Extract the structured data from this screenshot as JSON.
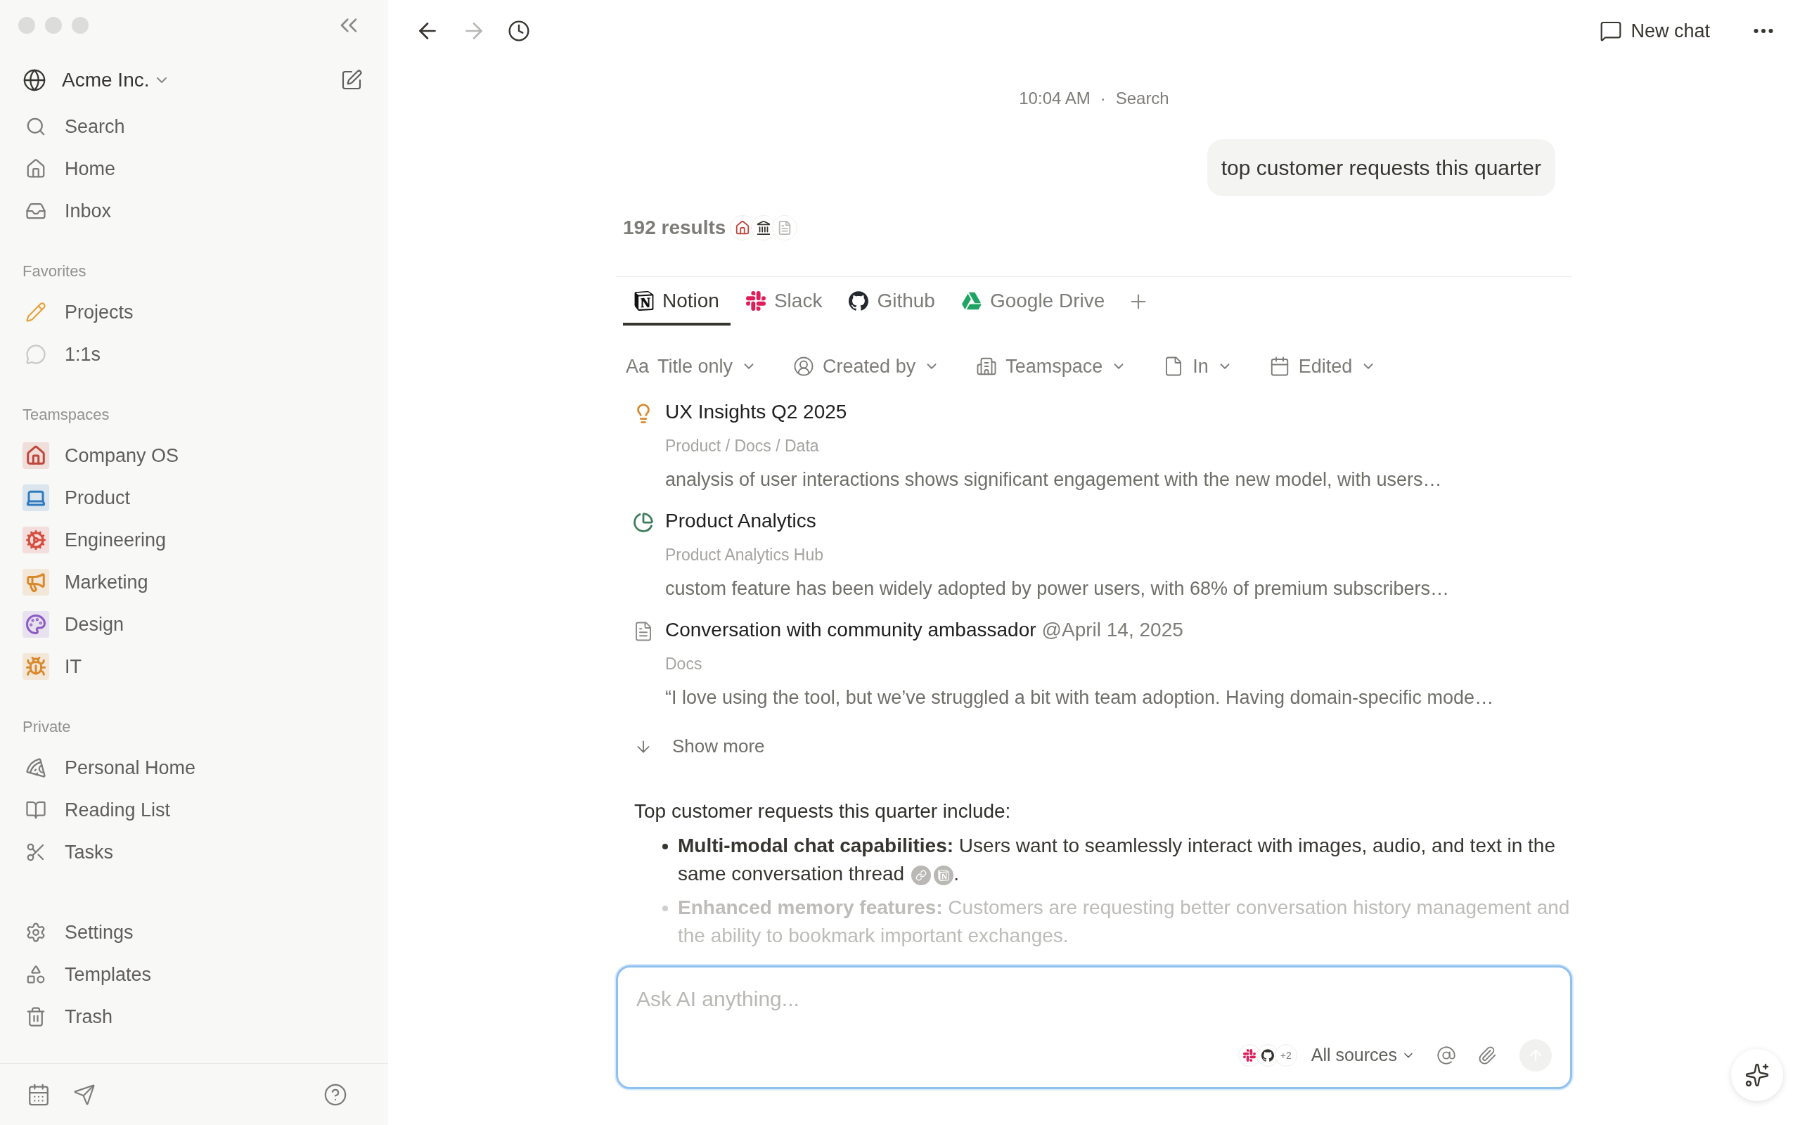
{
  "sidebar": {
    "workspace": {
      "name": "Acme Inc."
    },
    "nav": [
      {
        "label": "Search"
      },
      {
        "label": "Home"
      },
      {
        "label": "Inbox"
      }
    ],
    "sections": [
      {
        "title": "Favorites",
        "items": [
          {
            "label": "Projects",
            "color": "#e6a23c"
          },
          {
            "label": "1:1s",
            "color": "#c9c9c9"
          }
        ]
      },
      {
        "title": "Teamspaces",
        "items": [
          {
            "label": "Company OS",
            "color": "#c0473c"
          },
          {
            "label": "Product",
            "color": "#2f7bbf"
          },
          {
            "label": "Engineering",
            "color": "#d44c3f"
          },
          {
            "label": "Marketing",
            "color": "#d9892b"
          },
          {
            "label": "Design",
            "color": "#8a5bc4"
          },
          {
            "label": "IT",
            "color": "#d9892b"
          }
        ]
      },
      {
        "title": "Private",
        "items": [
          {
            "label": "Personal Home",
            "color": "#7d7c78"
          },
          {
            "label": "Reading List",
            "color": "#7d7c78"
          },
          {
            "label": "Tasks",
            "color": "#7d7c78"
          }
        ]
      }
    ],
    "bottom": [
      {
        "label": "Settings"
      },
      {
        "label": "Templates"
      },
      {
        "label": "Trash"
      }
    ]
  },
  "toolbar": {
    "new_chat": "New chat"
  },
  "chat": {
    "timestamp": "10:04 AM",
    "separator": "·",
    "mode": "Search",
    "query": "top customer requests this quarter",
    "results_count": "192 results",
    "tabs": [
      {
        "label": "Notion",
        "selected": true
      },
      {
        "label": "Slack",
        "selected": false
      },
      {
        "label": "Github",
        "selected": false
      },
      {
        "label": "Google Drive",
        "selected": false
      }
    ],
    "filters": [
      {
        "label": "Title only",
        "glyph": "Aa"
      },
      {
        "label": "Created by"
      },
      {
        "label": "Teamspace"
      },
      {
        "label": "In"
      },
      {
        "label": "Edited"
      }
    ],
    "results": [
      {
        "title": "UX Insights Q2 2025",
        "path": "Product / Docs / Data",
        "snippet": "analysis of user interactions shows significant engagement with the new model, with users…"
      },
      {
        "title": "Product Analytics",
        "path": "Product Analytics Hub",
        "snippet": "custom feature has been widely adopted by power users, with 68% of premium subscribers…"
      },
      {
        "title": "Conversation with community ambassador",
        "mention": "@April 14, 2025",
        "path": "Docs",
        "snippet": "“I love using the tool, but we’ve struggled a bit with team adoption. Having domain-specific mode…"
      }
    ],
    "show_more": "Show more",
    "answer": {
      "intro": "Top customer requests this quarter include:",
      "bullets": [
        {
          "text": "**Multi-modal chat capabilities:** Users want to seamlessly interact with images, audio, and text in the same conversation thread",
          "citations": true,
          "tail": ".",
          "faded": false
        },
        {
          "text": "**Enhanced memory features:** Customers are requesting better conversation history management and the ability to bookmark important exchanges.",
          "citations": false,
          "faded": true
        }
      ]
    }
  },
  "composer": {
    "placeholder": "Ask AI anything...",
    "extra_sources": "+2",
    "sources": "All sources"
  }
}
